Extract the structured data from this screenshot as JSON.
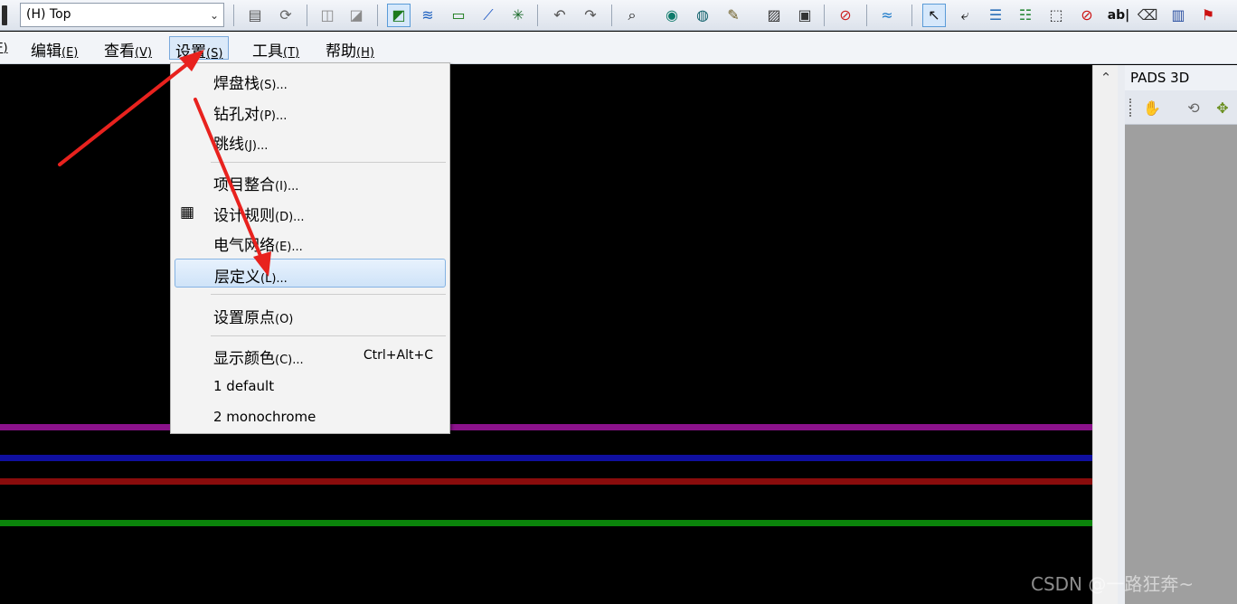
{
  "toolbar": {
    "layer_value": "(H) Top",
    "dropdown_glyph": "⌄",
    "buttons": [
      {
        "icon": "properties-icon",
        "glyph": "▤"
      },
      {
        "icon": "refresh-icon",
        "glyph": "⟳"
      },
      {
        "icon": "copy-icon",
        "glyph": "◫"
      },
      {
        "icon": "paste-icon",
        "glyph": "◪"
      },
      {
        "icon": "layer-pcb-icon",
        "glyph": "◩"
      },
      {
        "icon": "route-icon",
        "glyph": "≋"
      },
      {
        "icon": "board-outline-icon",
        "glyph": "▭"
      },
      {
        "icon": "line-draw-icon",
        "glyph": "⟋"
      },
      {
        "icon": "component-icon",
        "glyph": "✳"
      },
      {
        "icon": "undo-icon",
        "glyph": "↶"
      },
      {
        "icon": "redo-icon",
        "glyph": "↷"
      },
      {
        "icon": "zoom-icon",
        "glyph": "⌕"
      },
      {
        "icon": "find-icon",
        "glyph": "◉"
      },
      {
        "icon": "filter-icon",
        "glyph": "◍"
      },
      {
        "icon": "brush-icon",
        "glyph": "✎"
      },
      {
        "icon": "picture-icon",
        "glyph": "▨"
      },
      {
        "icon": "window-icon",
        "glyph": "▣"
      },
      {
        "icon": "measure-icon",
        "glyph": "⊘"
      },
      {
        "icon": "waveform-icon",
        "glyph": "≈"
      },
      {
        "icon": "select-arrow-icon",
        "glyph": "↖"
      },
      {
        "icon": "select-component-icon",
        "glyph": "⤶"
      },
      {
        "icon": "select-net-icon",
        "glyph": "☰"
      },
      {
        "icon": "select-trace-icon",
        "glyph": "☷"
      },
      {
        "icon": "select-pin-icon",
        "glyph": "⬚"
      },
      {
        "icon": "no-entry-icon",
        "glyph": "⊘"
      },
      {
        "icon": "text-icon",
        "glyph": "ab|"
      },
      {
        "icon": "eraser-icon",
        "glyph": "⌫"
      },
      {
        "icon": "books-icon",
        "glyph": "▥"
      },
      {
        "icon": "flag-icon",
        "glyph": "⚑"
      }
    ]
  },
  "menubar": {
    "partial": {
      "acc": "F",
      "close": ")"
    },
    "items": [
      {
        "label": "编辑",
        "acc": "(E)"
      },
      {
        "label": "查看",
        "acc": "(V)"
      },
      {
        "label": "设置",
        "acc": "(S)"
      },
      {
        "label": "工具",
        "acc": "(T)"
      },
      {
        "label": "帮助",
        "acc": "(H)"
      }
    ]
  },
  "menu": {
    "items": [
      {
        "label": "焊盘栈",
        "acc": "(S)..."
      },
      {
        "label": "钻孔对",
        "acc": "(P)..."
      },
      {
        "label": "跳线",
        "acc": "(J)..."
      },
      {
        "label": "项目整合",
        "acc": "(I)..."
      },
      {
        "label": "设计规则",
        "acc": "(D)...",
        "icon": "design-rules-icon",
        "glyph": "▦"
      },
      {
        "label": "电气网络",
        "acc": "(E)..."
      },
      {
        "label": "层定义",
        "acc": "(L)..."
      },
      {
        "label": "设置原点",
        "acc": "(O)"
      },
      {
        "label": "显示颜色",
        "acc": "(C)...",
        "shortcut": "Ctrl+Alt+C"
      },
      {
        "label": "1 default",
        "acc": ""
      },
      {
        "label": "2 monochrome",
        "acc": ""
      }
    ]
  },
  "canvas": {
    "traces": [
      {
        "color": "#8b128b"
      },
      {
        "color": "#0f0fa0"
      },
      {
        "color": "#8a0c0c"
      },
      {
        "color": "#0b840b"
      }
    ]
  },
  "scrollbar": {
    "up_glyph": "⌃"
  },
  "pads3d": {
    "title": "PADS 3D",
    "tools": [
      {
        "icon": "hand-icon",
        "glyph": "✋"
      },
      {
        "icon": "rotate-icon",
        "glyph": "⟲"
      },
      {
        "icon": "fit-icon",
        "glyph": "✥"
      }
    ]
  },
  "watermark": "CSDN @一路狂奔~",
  "colors": {
    "arrow": "#e8221e",
    "highlight": "#cfe3f8"
  }
}
